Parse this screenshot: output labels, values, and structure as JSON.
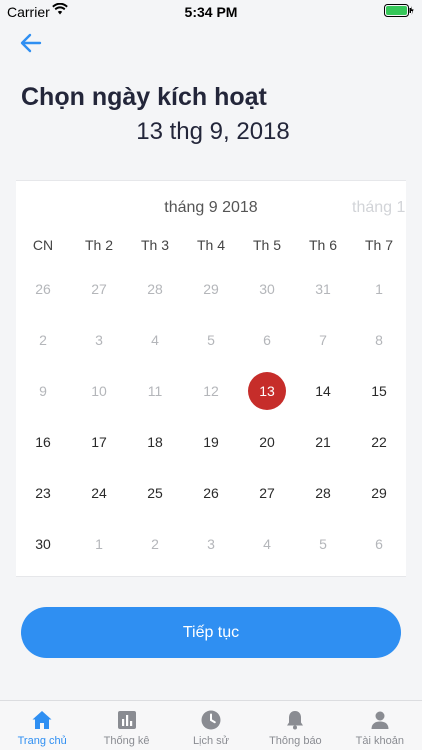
{
  "status_bar": {
    "carrier": "Carrier",
    "time": "5:34 PM"
  },
  "header": {
    "title": "Chọn ngày kích hoạt",
    "selected_date": "13 thg 9, 2018"
  },
  "calendar": {
    "month_label": "tháng 9 2018",
    "next_month_label": "tháng 1",
    "weekdays": [
      "CN",
      "Th 2",
      "Th 3",
      "Th 4",
      "Th 5",
      "Th 6",
      "Th 7"
    ],
    "selected_day": "13",
    "weeks": [
      [
        {
          "d": "26",
          "muted": true
        },
        {
          "d": "27",
          "muted": true
        },
        {
          "d": "28",
          "muted": true
        },
        {
          "d": "29",
          "muted": true
        },
        {
          "d": "30",
          "muted": true
        },
        {
          "d": "31",
          "muted": true
        },
        {
          "d": "1",
          "muted": true
        }
      ],
      [
        {
          "d": "2",
          "muted": true
        },
        {
          "d": "3",
          "muted": true
        },
        {
          "d": "4",
          "muted": true
        },
        {
          "d": "5",
          "muted": true
        },
        {
          "d": "6",
          "muted": true
        },
        {
          "d": "7",
          "muted": true
        },
        {
          "d": "8",
          "muted": true
        }
      ],
      [
        {
          "d": "9",
          "muted": true
        },
        {
          "d": "10",
          "muted": true
        },
        {
          "d": "11",
          "muted": true
        },
        {
          "d": "12",
          "muted": true
        },
        {
          "d": "13",
          "muted": false,
          "selected": true
        },
        {
          "d": "14",
          "muted": false
        },
        {
          "d": "15",
          "muted": false
        }
      ],
      [
        {
          "d": "16",
          "muted": false
        },
        {
          "d": "17",
          "muted": false
        },
        {
          "d": "18",
          "muted": false
        },
        {
          "d": "19",
          "muted": false
        },
        {
          "d": "20",
          "muted": false
        },
        {
          "d": "21",
          "muted": false
        },
        {
          "d": "22",
          "muted": false
        }
      ],
      [
        {
          "d": "23",
          "muted": false
        },
        {
          "d": "24",
          "muted": false
        },
        {
          "d": "25",
          "muted": false
        },
        {
          "d": "26",
          "muted": false
        },
        {
          "d": "27",
          "muted": false
        },
        {
          "d": "28",
          "muted": false
        },
        {
          "d": "29",
          "muted": false
        }
      ],
      [
        {
          "d": "30",
          "muted": false
        },
        {
          "d": "1",
          "muted": true
        },
        {
          "d": "2",
          "muted": true
        },
        {
          "d": "3",
          "muted": true
        },
        {
          "d": "4",
          "muted": true
        },
        {
          "d": "5",
          "muted": true
        },
        {
          "d": "6",
          "muted": true
        }
      ]
    ]
  },
  "actions": {
    "continue_label": "Tiếp tục"
  },
  "tab_bar": {
    "tabs": [
      {
        "label": "Trang chủ",
        "icon": "home-icon",
        "active": true
      },
      {
        "label": "Thống kê",
        "icon": "stats-icon",
        "active": false
      },
      {
        "label": "Lịch sử",
        "icon": "history-icon",
        "active": false
      },
      {
        "label": "Thông báo",
        "icon": "bell-icon",
        "active": false
      },
      {
        "label": "Tài khoản",
        "icon": "account-icon",
        "active": false
      }
    ]
  },
  "colors": {
    "accent": "#2f8ff2",
    "selected": "#c62d2a",
    "background": "#f4f5f7"
  }
}
